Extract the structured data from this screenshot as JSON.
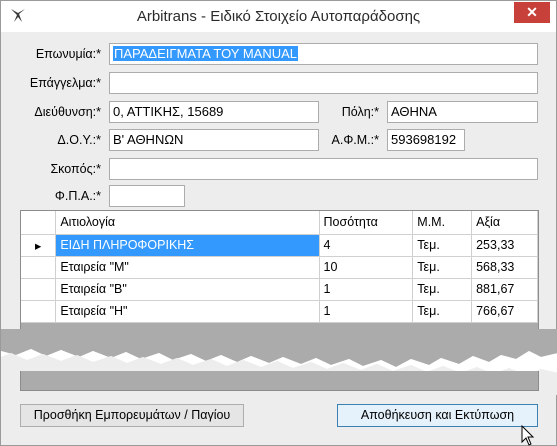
{
  "window": {
    "title": "Arbitrans - Ειδικό Στοιχείο Αυτοπαράδοσης",
    "close_label": "✕"
  },
  "form": {
    "eponymia_label": "Επωνυμία:*",
    "eponymia_value": "ΠΑΡΑΔΕΙΓΜΑΤΑ ΤΟΥ MANUAL",
    "epaggelma_label": "Επάγγελμα:*",
    "epaggelma_value": "",
    "dieythynsi_label": "Διεύθυνση:*",
    "dieythynsi_value": "0, ΑΤΤΙΚΗΣ, 15689",
    "poli_label": "Πόλη:*",
    "poli_value": "ΑΘΗΝΑ",
    "doy_label": "Δ.Ο.Υ.:*",
    "doy_value": "Β' ΑΘΗΝΩΝ",
    "afm_label": "Α.Φ.Μ.:*",
    "afm_value": "593698192",
    "skopos_label": "Σκοπός:*",
    "skopos_value": "",
    "fpa_label": "Φ.Π.Α.:*",
    "fpa_value": ""
  },
  "grid": {
    "columns": [
      "Αιτιολογία",
      "Ποσότητα",
      "Μ.Μ.",
      "Αξία"
    ],
    "rows": [
      [
        "ΕΙΔΗ ΠΛΗΡΟΦΟΡΙΚΗΣ",
        "4",
        "Τεμ.",
        "253,33"
      ],
      [
        "Εταιρεία \"Μ\"",
        "10",
        "Τεμ.",
        "568,33"
      ],
      [
        "Εταιρεία \"Β\"",
        "1",
        "Τεμ.",
        "881,67"
      ],
      [
        "Εταιρεία \"Η\"",
        "1",
        "Τεμ.",
        "766,67"
      ]
    ],
    "selected_row": 0,
    "current_row_marker": "▸"
  },
  "buttons": {
    "add_goods": "Προσθήκη Εμπορευμάτων / Παγίου",
    "save_print": "Αποθήκευση και Εκτύπωση"
  },
  "colors": {
    "selection": "#3399ff",
    "close_button": "#c7403a"
  }
}
